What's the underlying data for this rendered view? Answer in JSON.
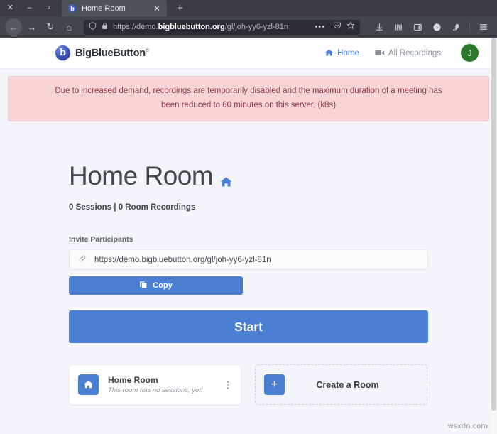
{
  "browser": {
    "window_controls": {
      "close": "✕",
      "minimize": "–",
      "maximize": "▫"
    },
    "tab": {
      "title": "Home Room",
      "favicon_letter": "b",
      "close": "✕"
    },
    "new_tab_label": "+",
    "toolbar": {
      "back": "←",
      "forward": "→",
      "reload": "↻",
      "home": "⌂",
      "page_actions": "•••",
      "url_prefix": "https://demo.",
      "url_host": "bigbluebutton.org",
      "url_path": "/gl/joh-yy6-yzl-81n"
    }
  },
  "site_header": {
    "brand_name": "BigBlueButton",
    "brand_mark_letter": "b",
    "brand_tm": "®",
    "nav": [
      {
        "label": "Home",
        "icon": "home-icon",
        "active": true
      },
      {
        "label": "All Recordings",
        "icon": "video-camera-icon",
        "active": false
      }
    ],
    "avatar_initial": "J"
  },
  "alert": {
    "message": "Due to increased demand, recordings are temporarily disabled and the maximum duration of a meeting has been reduced to 60 minutes on this server. (k8s)"
  },
  "main": {
    "room_title": "Home Room",
    "room_stats": "0 Sessions | 0 Room Recordings",
    "invite_label": "Invite Participants",
    "invite_url": "https://demo.bigbluebutton.org/gl/joh-yy6-yzl-81n",
    "copy_button": "Copy",
    "start_button": "Start"
  },
  "room_cards": [
    {
      "title": "Home Room",
      "subtitle": "This room has no sessions, yet!",
      "icon": "home-icon"
    }
  ],
  "create_room_card": {
    "label": "Create a Room",
    "icon": "plus-icon"
  },
  "watermark": "wsxdn.com",
  "colors": {
    "accent_blue": "#4a7fd4",
    "avatar_green": "#2b7a2b",
    "alert_bg": "#f6d3d6",
    "alert_text": "#8d3a42",
    "page_bg": "#f4f5f9"
  }
}
